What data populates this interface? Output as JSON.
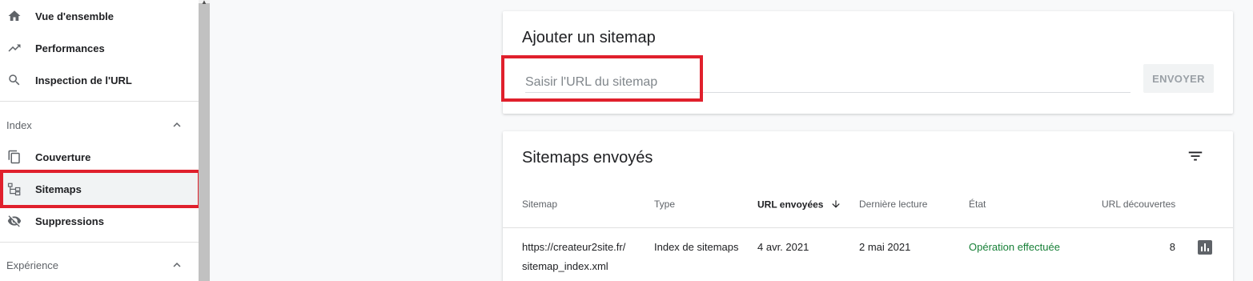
{
  "sidebar": {
    "items": [
      {
        "label": "Vue d'ensemble",
        "icon": "home-icon"
      },
      {
        "label": "Performances",
        "icon": "trending-up-icon"
      },
      {
        "label": "Inspection de l'URL",
        "icon": "search-icon"
      }
    ],
    "sections": [
      {
        "label": "Index",
        "items": [
          {
            "label": "Couverture",
            "icon": "copy-pages-icon"
          },
          {
            "label": "Sitemaps",
            "icon": "sitemap-tree-icon",
            "active": true
          },
          {
            "label": "Suppressions",
            "icon": "eye-off-icon"
          }
        ]
      },
      {
        "label": "Expérience",
        "items": []
      }
    ]
  },
  "add_sitemap": {
    "title": "Ajouter un sitemap",
    "input_placeholder": "Saisir l'URL du sitemap",
    "input_value": "",
    "submit_label": "ENVOYER"
  },
  "submitted": {
    "title": "Sitemaps envoyés",
    "columns": [
      "Sitemap",
      "Type",
      "URL envoyées",
      "Dernière lecture",
      "État",
      "URL découvertes"
    ],
    "rows": [
      {
        "sitemap_line1": "https://createur2site.fr/",
        "sitemap_line2": "sitemap_index.xml",
        "type": "Index de sitemaps",
        "submitted": "4 avr. 2021",
        "last_read": "2 mai 2021",
        "status": "Opération effectuée",
        "discovered": "8"
      }
    ]
  },
  "colors": {
    "highlight": "#e0202c",
    "success": "#188038"
  }
}
